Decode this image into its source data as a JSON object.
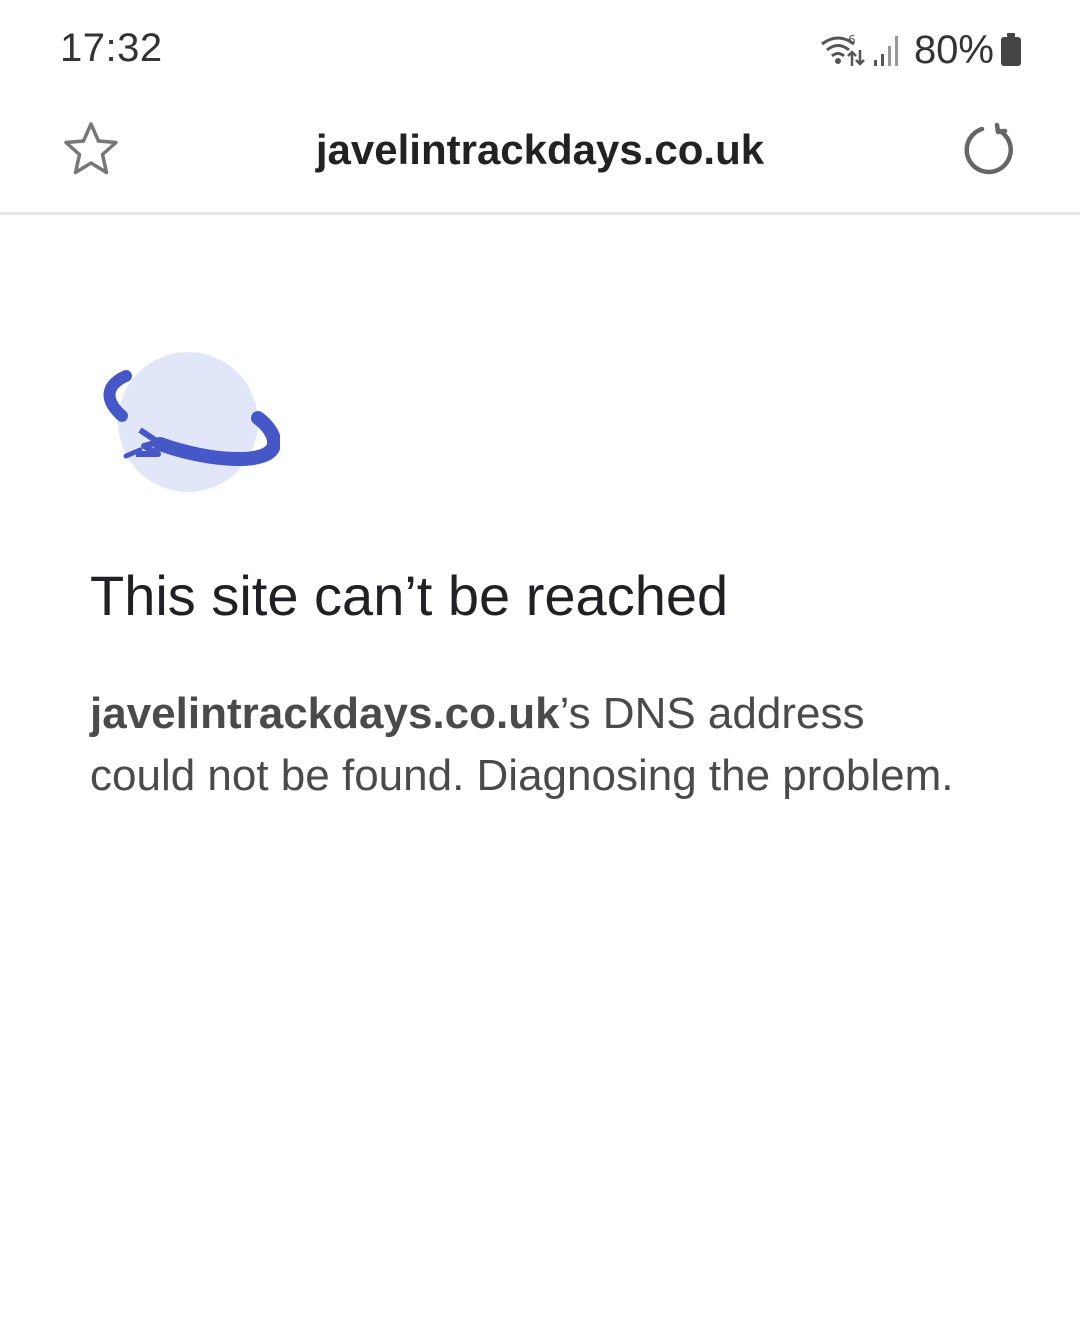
{
  "status_bar": {
    "time": "17:32",
    "battery_percent": "80%",
    "icons": [
      "wifi-data-icon",
      "signal-icon",
      "battery-icon"
    ]
  },
  "toolbar": {
    "url": "javelintrackdays.co.uk",
    "icons": [
      "star-icon",
      "reload-icon"
    ]
  },
  "error": {
    "illustration": "disconnected-planet-icon",
    "title": "This site can’t be reached",
    "host": "javelintrackdays.co.uk",
    "message": "’s DNS address could not be found. Diagnosing the problem."
  },
  "colors": {
    "planet_body": "#e1e6f9",
    "planet_ring": "#4658c8",
    "icon_gray": "#666666",
    "divider": "#e6e6e6"
  }
}
